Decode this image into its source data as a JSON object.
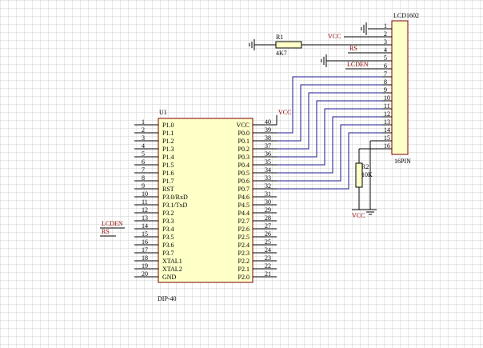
{
  "ic": {
    "ref": "U1",
    "package": "DIP-40",
    "left_pins": [
      {
        "num": "1",
        "name": "P1.0"
      },
      {
        "num": "2",
        "name": "P1.1"
      },
      {
        "num": "3",
        "name": "P1.2"
      },
      {
        "num": "4",
        "name": "P1.3"
      },
      {
        "num": "5",
        "name": "P1.4"
      },
      {
        "num": "6",
        "name": "P1.5"
      },
      {
        "num": "7",
        "name": "P1.6"
      },
      {
        "num": "8",
        "name": "P1.7"
      },
      {
        "num": "9",
        "name": "RST"
      },
      {
        "num": "10",
        "name": "P3.0/RxD"
      },
      {
        "num": "11",
        "name": "P3.1/TxD"
      },
      {
        "num": "12",
        "name": "P3.2"
      },
      {
        "num": "13",
        "name": "P3.3"
      },
      {
        "num": "14",
        "name": "P3.4"
      },
      {
        "num": "15",
        "name": "P3.5"
      },
      {
        "num": "16",
        "name": "P3.6"
      },
      {
        "num": "17",
        "name": "P3.7"
      },
      {
        "num": "18",
        "name": "XTAL1"
      },
      {
        "num": "19",
        "name": "XTAL2"
      },
      {
        "num": "20",
        "name": "GND"
      }
    ],
    "right_pins": [
      {
        "num": "40",
        "name": "VCC"
      },
      {
        "num": "39",
        "name": "P0.0"
      },
      {
        "num": "38",
        "name": "P0.1"
      },
      {
        "num": "37",
        "name": "P0.2"
      },
      {
        "num": "36",
        "name": "P0.3"
      },
      {
        "num": "35",
        "name": "P0.4"
      },
      {
        "num": "34",
        "name": "P0.5"
      },
      {
        "num": "33",
        "name": "P0.6"
      },
      {
        "num": "32",
        "name": "P0.7"
      },
      {
        "num": "31",
        "name": "P4.6"
      },
      {
        "num": "30",
        "name": "P4.5"
      },
      {
        "num": "29",
        "name": "P4.4"
      },
      {
        "num": "28",
        "name": "P2.7"
      },
      {
        "num": "27",
        "name": "P2.6"
      },
      {
        "num": "26",
        "name": "P2.5"
      },
      {
        "num": "25",
        "name": "P2.4"
      },
      {
        "num": "24",
        "name": "P2.3"
      },
      {
        "num": "23",
        "name": "P2.2"
      },
      {
        "num": "22",
        "name": "P2.1"
      },
      {
        "num": "21",
        "name": "P2.0"
      }
    ]
  },
  "lcd": {
    "ref": "LCD1602",
    "package": "16PIN",
    "pins": [
      "1",
      "2",
      "3",
      "4",
      "5",
      "6",
      "7",
      "8",
      "9",
      "10",
      "11",
      "12",
      "13",
      "14",
      "15",
      "16"
    ]
  },
  "r1": {
    "ref": "R1",
    "value": "4K7"
  },
  "r2": {
    "ref": "R2",
    "value": "10K"
  },
  "nets": {
    "vcc": "VCC",
    "rs": "RS",
    "lcden": "LCDEN"
  },
  "colors": {
    "background": "#ffffff",
    "grid": "#d2d2d2",
    "ic_body": "#ffffc8",
    "wire_blue": "#1a1a8c",
    "wire_dark": "#000000",
    "label_red": "#8b0000"
  }
}
